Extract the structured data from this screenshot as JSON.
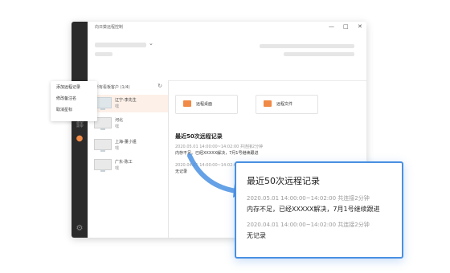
{
  "window": {
    "title": "向日葵远程控制",
    "controls": [
      "—",
      "□",
      "✕"
    ],
    "accent": "#f08a46"
  },
  "rail": {
    "icons": [
      "link-icon",
      "user-group-icon",
      "settings-icon"
    ]
  },
  "sidebar": {
    "title": "所有看板客户 (1/4)",
    "devices": [
      {
        "name": "辽宁-李先生",
        "sub": "嘿",
        "selected": true
      },
      {
        "name": "河北",
        "sub": "嘿",
        "selected": false
      },
      {
        "name": "上海-董小姐",
        "sub": "嘿",
        "selected": false
      },
      {
        "name": "广东-陈工",
        "sub": "嘿",
        "selected": false
      }
    ]
  },
  "menu": {
    "items": [
      "添加远程记录",
      "修改备注名",
      "取消星标"
    ]
  },
  "main": {
    "buttons": [
      {
        "label": "远程桌面"
      },
      {
        "label": "远程文件"
      }
    ],
    "records_title": "最近50次远程记录",
    "records": [
      {
        "meta": "2020.05.01  14:00:00~14:02:00    共连接2分钟",
        "detail": "内存不足。已经XXXXX解决，7月1号继续跟进"
      },
      {
        "meta": "2020.04.01  14:00:00~14:02:00    共连接2分钟",
        "detail": "无记录"
      }
    ]
  },
  "popup": {
    "title": "最近50次远程记录",
    "records": [
      {
        "meta": "2020.05.01   14:00:00~14:02:00    共连接2分钟",
        "detail": "内存不足，已经XXXXX解决，7月1号继续跟进"
      },
      {
        "meta": "2020.04.01   14:00:00~14:02:00    共连接2分钟",
        "detail": "无记录"
      }
    ],
    "border_color": "#4a90e2"
  }
}
